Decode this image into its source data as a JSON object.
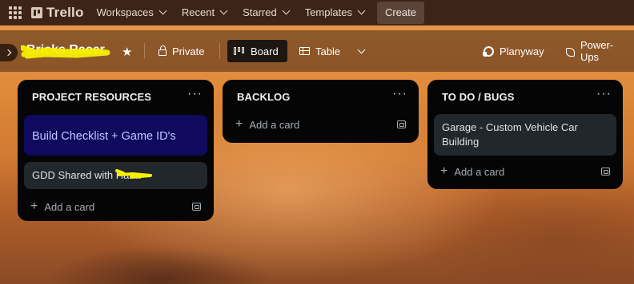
{
  "top_nav": {
    "logo_text": "Trello",
    "items": [
      "Workspaces",
      "Recent",
      "Starred",
      "Templates"
    ],
    "create_label": "Create"
  },
  "board_bar": {
    "board_title": "Bricks Racer",
    "visibility_label": "Private",
    "views": [
      "Board",
      "Table"
    ],
    "active_view": "Board",
    "right_items": [
      "Planyway",
      "Power-Ups"
    ]
  },
  "lists": [
    {
      "title": "PROJECT RESOURCES",
      "cards": [
        {
          "text": "Build Checklist + Game ID's",
          "cover_color": "#0f0a5e"
        },
        {
          "text": "GDD Shared with Hana"
        }
      ],
      "add_label": "Add a card"
    },
    {
      "title": "BACKLOG",
      "cards": [],
      "add_label": "Add a card"
    },
    {
      "title": "TO DO / BUGS",
      "cards": [
        {
          "text": "Garage - Custom Vehicle Car Building"
        }
      ],
      "add_label": "Add a card"
    }
  ],
  "colors": {
    "topbar_bg": "#3d2418",
    "list_bg": "#050505",
    "card_bg": "#22272b",
    "highlight_scribble": "#f5f000"
  }
}
